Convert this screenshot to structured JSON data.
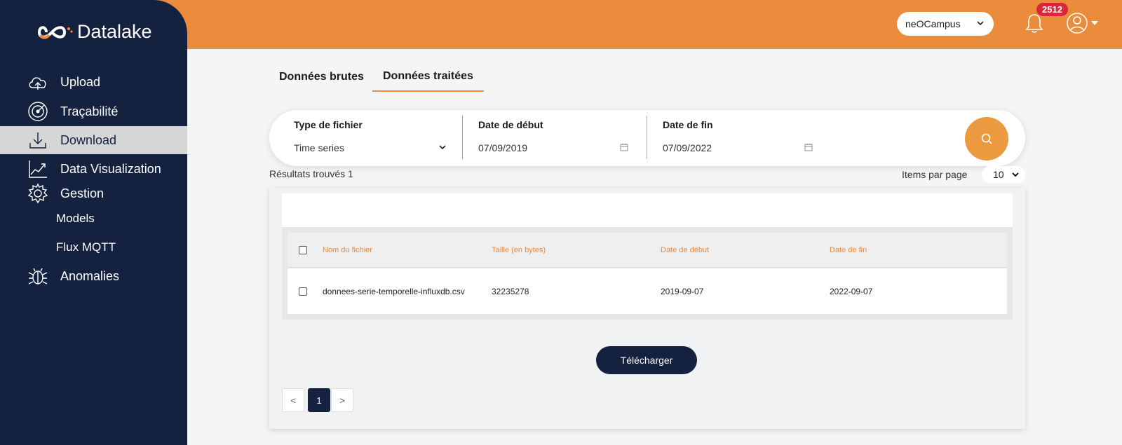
{
  "app": {
    "title": "Datalake"
  },
  "sidebar": {
    "items": [
      {
        "label": "Upload",
        "icon": "cloud-upload-icon"
      },
      {
        "label": "Traçabilité",
        "icon": "radar-icon"
      },
      {
        "label": "Download",
        "icon": "download-icon",
        "active": true
      },
      {
        "label": "Data Visualization",
        "icon": "chart-icon"
      },
      {
        "label": "Gestion",
        "icon": "gear-icon"
      },
      {
        "label": "Anomalies",
        "icon": "bug-icon"
      }
    ],
    "sub_items": [
      "Models",
      "Flux MQTT"
    ]
  },
  "header": {
    "org_select": "neOCampus",
    "notification_count": "2512"
  },
  "tabs": [
    {
      "label": "Données brutes",
      "active": false
    },
    {
      "label": "Données traitées",
      "active": true
    }
  ],
  "filters": {
    "type_label": "Type de fichier",
    "type_value": "Time series",
    "start_label": "Date de début",
    "start_value": "07/09/2019",
    "end_label": "Date de fin",
    "end_value": "07/09/2022"
  },
  "results_text": "Résultats trouvés 1",
  "items_per_page": {
    "label": "Items par page",
    "value": "10"
  },
  "table": {
    "columns": [
      "Nom du fichier",
      "Taille (en bytes)",
      "Date de début",
      "Date de fin"
    ],
    "rows": [
      [
        "donnees-serie-temporelle-influxdb.csv",
        "32235278",
        "2019-09-07",
        "2022-09-07"
      ]
    ]
  },
  "download_button": "Télécharger",
  "pagination": {
    "prev": "<",
    "current": "1",
    "next": ">"
  },
  "colors": {
    "sidebar": "#142240",
    "accent": "#eb8b3c",
    "badge": "#d8263b"
  }
}
